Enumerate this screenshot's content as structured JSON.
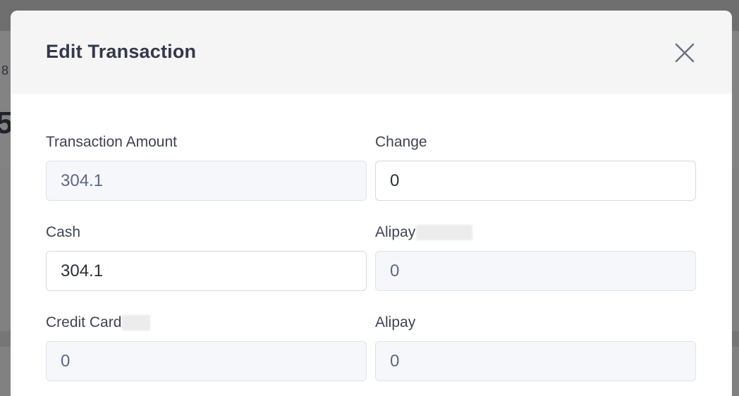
{
  "background": {
    "partial_text_small": "8",
    "partial_text_big": "5"
  },
  "modal": {
    "title": "Edit Transaction",
    "close_icon": "close-icon"
  },
  "fields": {
    "transaction_amount": {
      "label": "Transaction Amount",
      "value": "304.1"
    },
    "change": {
      "label": "Change",
      "value": "0"
    },
    "cash": {
      "label": "Cash",
      "value": "304.1"
    },
    "alipay_1": {
      "label": "Alipay",
      "value": "0"
    },
    "credit_card": {
      "label": "Credit Card",
      "value": "0"
    },
    "alipay_2": {
      "label": "Alipay",
      "value": "0"
    }
  },
  "colors": {
    "overlay": "#7b7b7b",
    "header_bg": "#f5f5f5",
    "readonly_bg": "#f5f7fa",
    "title_text": "#33394a"
  }
}
